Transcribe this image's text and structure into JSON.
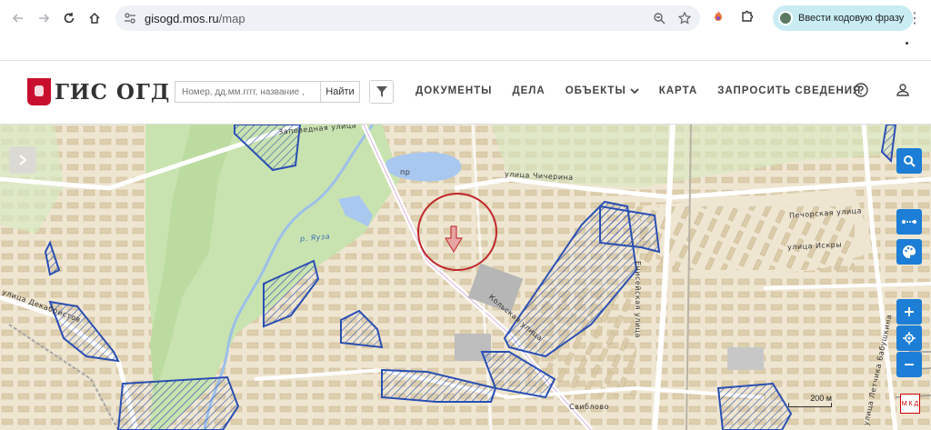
{
  "browser": {
    "url_host": "gisogd.mos.ru",
    "url_path": "/map",
    "promo_chip": "Ввести кодовую фразу",
    "icons": [
      "back-arrow-icon",
      "forward-arrow-icon",
      "reload-icon",
      "home-icon",
      "site-info-icon",
      "zoom-icon",
      "star-icon",
      "extension-icon",
      "puzzle-icon",
      "kebab-icon"
    ]
  },
  "header": {
    "logo_text": "ГИС ОГД",
    "search_placeholder": "Номер, дд.мм.гггг, название ,",
    "search_button": "Найти",
    "nav": [
      {
        "label": "ДОКУМЕНТЫ"
      },
      {
        "label": "ДЕЛА"
      },
      {
        "label": "ОБЪЕКТЫ"
      },
      {
        "label": "КАРТА"
      },
      {
        "label": "ЗАПРОСИТЬ СВЕДЕНИЯ"
      }
    ]
  },
  "map": {
    "labels": [
      {
        "text": "Заповедная улица"
      },
      {
        "text": "пр"
      },
      {
        "text": "улица Чичерина"
      },
      {
        "text": "Печорская улица"
      },
      {
        "text": "улица Искры"
      },
      {
        "text": "р. Яуза"
      },
      {
        "text": "Кольская улица"
      },
      {
        "text": "Енисейская улица"
      },
      {
        "text": "улица Декабристов"
      },
      {
        "text": "улица Летчика Бабушкина"
      },
      {
        "text": "Свиблово"
      }
    ],
    "scale": "200 м",
    "metro_label": "М К Д",
    "controls": [
      "search-icon",
      "measure-icon",
      "palette-icon",
      "zoom-in-icon",
      "locate-icon",
      "zoom-out-icon"
    ],
    "colors": {
      "accent": "#1c7ed6",
      "zone": "#2a4fb3",
      "highlight": "#c0282b",
      "greenery": "#c9e3b0",
      "water": "#a8c8f0"
    }
  }
}
